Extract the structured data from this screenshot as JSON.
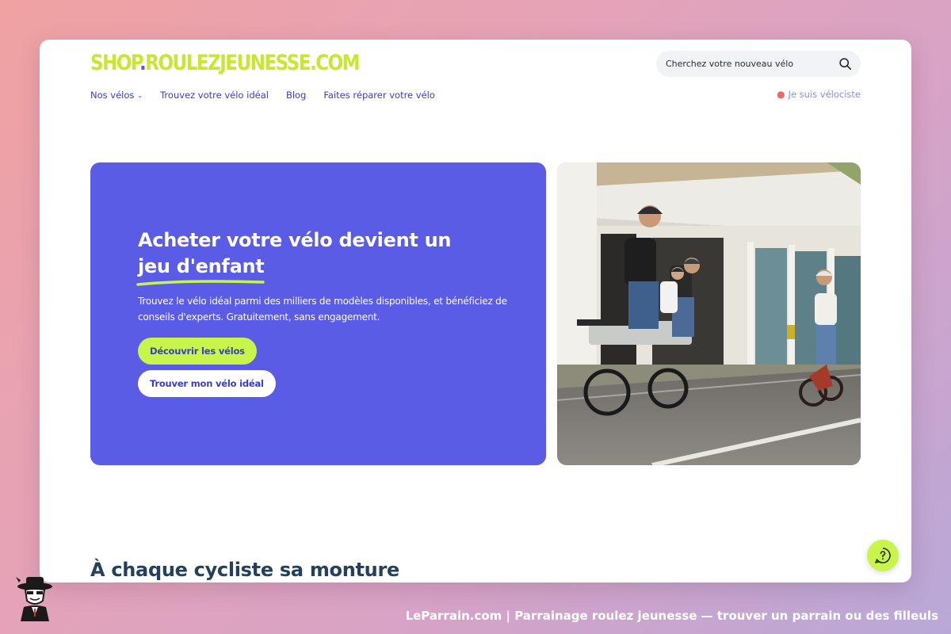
{
  "site": {
    "logo_main": "SHOP",
    "logo_dot": ".",
    "logo_rest": "ROULEZJEUNESSE",
    "logo_tld": ".COM"
  },
  "search": {
    "placeholder": "Cherchez votre nouveau vélo"
  },
  "nav": {
    "items": [
      {
        "label": "Nos vélos",
        "has_dropdown": true
      },
      {
        "label": "Trouvez votre vélo idéal"
      },
      {
        "label": "Blog"
      },
      {
        "label": "Faites réparer votre vélo"
      }
    ],
    "velociste": "Je suis vélociste"
  },
  "hero": {
    "title_line1": "Acheter votre vélo devient un",
    "title_highlight": "jeu d'enfant",
    "description": "Trouvez le vélo idéal parmi des milliers de modèles disponibles, et bénéficiez de conseils d'experts. Gratuitement, sans engagement.",
    "primary_button": "Découvrir les vélos",
    "secondary_button": "Trouver mon vélo idéal"
  },
  "section": {
    "title": "À chaque cycliste sa monture"
  },
  "footer": {
    "caption": "LeParrain.com | Parrainage roulez jeunesse — trouver un parrain ou des filleuls"
  },
  "colors": {
    "brand_blue": "#5a5ce6",
    "brand_lime": "#c8f54a",
    "nav_text": "#3b3ec4",
    "heading": "#24405a"
  },
  "icons": [
    "search-icon",
    "chevron-down-icon",
    "location-pin-icon",
    "help-icon",
    "mascot-icon"
  ]
}
